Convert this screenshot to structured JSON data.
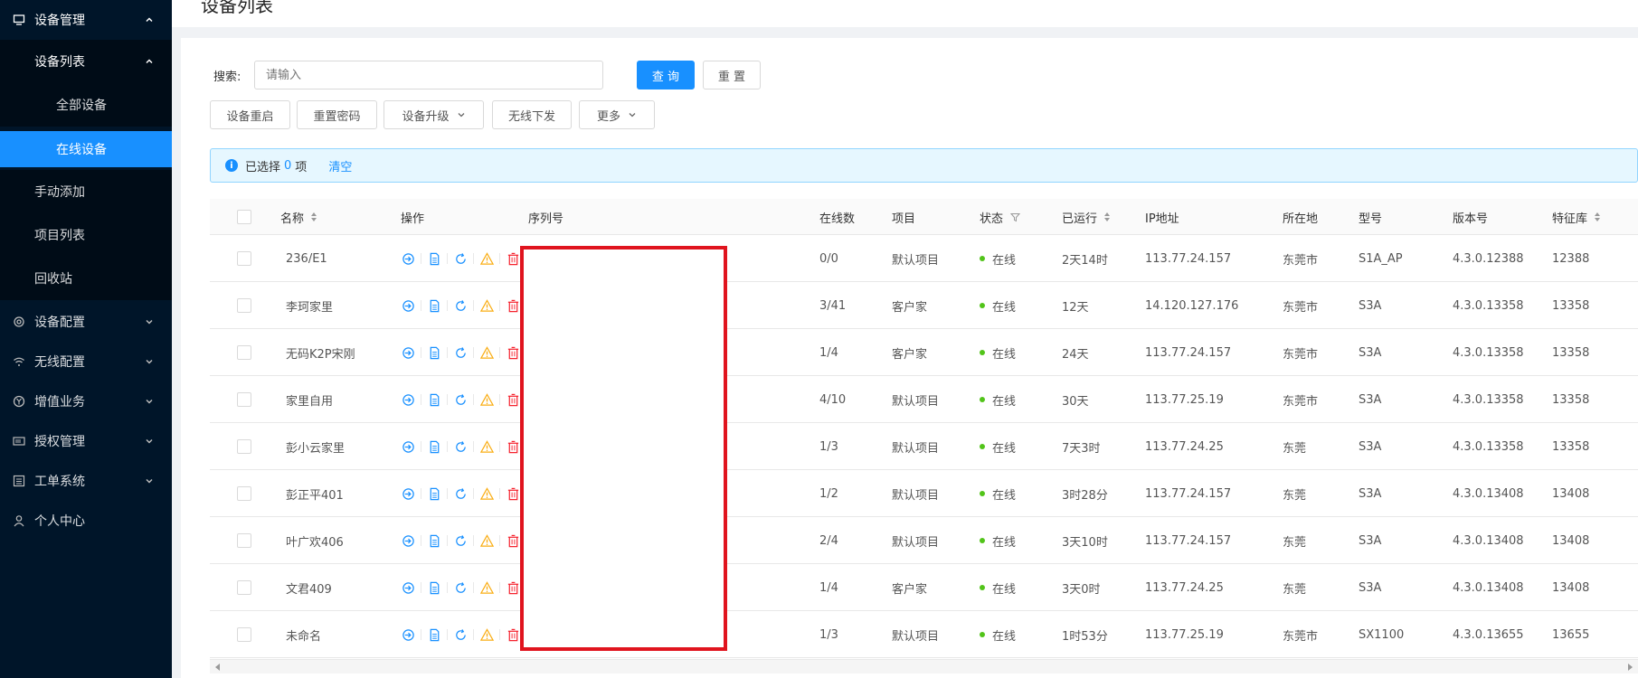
{
  "sidebar": {
    "device_mgmt": "设备管理",
    "device_list": "设备列表",
    "all_devices": "全部设备",
    "online_devices": "在线设备",
    "manual_add": "手动添加",
    "project_list": "项目列表",
    "recycle_bin": "回收站",
    "device_config": "设备配置",
    "wireless_config": "无线配置",
    "value_added": "增值业务",
    "license_mgmt": "授权管理",
    "ticket_system": "工单系统",
    "personal_center": "个人中心"
  },
  "page": {
    "title": "设备列表"
  },
  "search": {
    "label": "搜索:",
    "placeholder": "请输入",
    "query_button": "查 询",
    "reset_button": "重 置"
  },
  "toolbar": {
    "reboot": "设备重启",
    "reset_password": "重置密码",
    "upgrade": "设备升级",
    "wireless_push": "无线下发",
    "more": "更多"
  },
  "alert": {
    "prefix": "已选择",
    "count": "0",
    "suffix": "项",
    "clear": "清空"
  },
  "table": {
    "headers": {
      "name": "名称",
      "actions": "操作",
      "serial": "序列号",
      "online_count": "在线数",
      "project": "项目",
      "status": "状态",
      "uptime": "已运行",
      "ip": "IP地址",
      "location": "所在地",
      "model": "型号",
      "version": "版本号",
      "feature_lib": "特征库"
    },
    "rows": [
      {
        "name": "236/E1",
        "online": "0/0",
        "project": "默认项目",
        "status": "在线",
        "uptime": "2天14时",
        "ip": "113.77.24.157",
        "location": "东莞市",
        "model": "S1A_AP",
        "version": "4.3.0.12388",
        "feature": "12388"
      },
      {
        "name": "李珂家里",
        "online": "3/41",
        "project": "客户家",
        "status": "在线",
        "uptime": "12天",
        "ip": "14.120.127.176",
        "location": "东莞市",
        "model": "S3A",
        "version": "4.3.0.13358",
        "feature": "13358"
      },
      {
        "name": "无码K2P宋刚",
        "online": "1/4",
        "project": "客户家",
        "status": "在线",
        "uptime": "24天",
        "ip": "113.77.24.157",
        "location": "东莞市",
        "model": "S3A",
        "version": "4.3.0.13358",
        "feature": "13358"
      },
      {
        "name": "家里自用",
        "online": "4/10",
        "project": "默认项目",
        "status": "在线",
        "uptime": "30天",
        "ip": "113.77.25.19",
        "location": "东莞市",
        "model": "S3A",
        "version": "4.3.0.13358",
        "feature": "13358"
      },
      {
        "name": "彭小云家里",
        "online": "1/3",
        "project": "默认项目",
        "status": "在线",
        "uptime": "7天3时",
        "ip": "113.77.24.25",
        "location": "东莞",
        "model": "S3A",
        "version": "4.3.0.13358",
        "feature": "13358"
      },
      {
        "name": "彭正平401",
        "online": "1/2",
        "project": "默认项目",
        "status": "在线",
        "uptime": "3时28分",
        "ip": "113.77.24.157",
        "location": "东莞",
        "model": "S3A",
        "version": "4.3.0.13408",
        "feature": "13408"
      },
      {
        "name": "叶广欢406",
        "online": "2/4",
        "project": "默认项目",
        "status": "在线",
        "uptime": "3天10时",
        "ip": "113.77.24.157",
        "location": "东莞",
        "model": "S3A",
        "version": "4.3.0.13408",
        "feature": "13408"
      },
      {
        "name": "文君409",
        "online": "1/4",
        "project": "客户家",
        "status": "在线",
        "uptime": "3天0时",
        "ip": "113.77.24.25",
        "location": "东莞",
        "model": "S3A",
        "version": "4.3.0.13408",
        "feature": "13408"
      },
      {
        "name": "未命名",
        "online": "1/3",
        "project": "默认项目",
        "status": "在线",
        "uptime": "1时53分",
        "ip": "113.77.25.19",
        "location": "东莞市",
        "model": "SX1100",
        "version": "4.3.0.13655",
        "feature": "13655"
      }
    ]
  },
  "colors": {
    "sidebar_bg": "#001529",
    "sidebar_sub_bg": "#000c17",
    "accent": "#1890ff",
    "online_dot": "#52c41a",
    "redaction_border": "#e0141e"
  }
}
